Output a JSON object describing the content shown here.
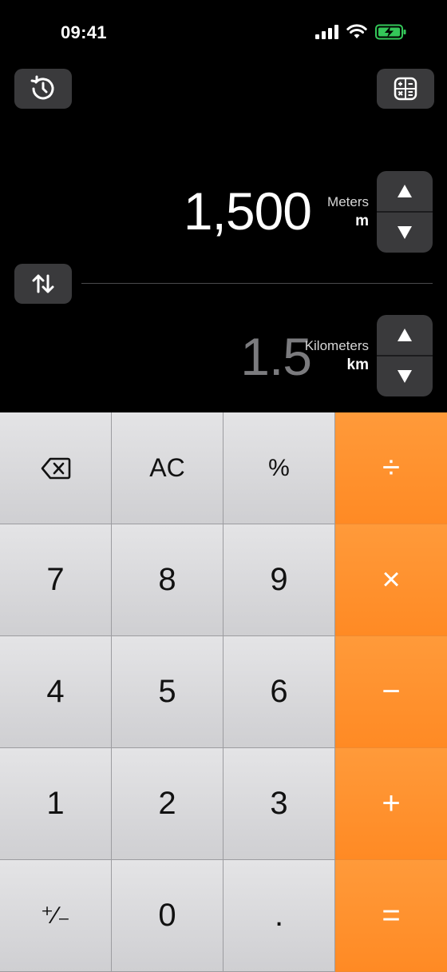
{
  "status_bar": {
    "time": "09:41"
  },
  "toolbar": {
    "history_icon": "history-icon",
    "calculator_icon": "calculator-icon"
  },
  "input": {
    "value": "1,500",
    "unit_name": "Meters",
    "unit_abbr": "m"
  },
  "output": {
    "value": "1.5",
    "unit_name": "Kilometers",
    "unit_abbr": "km"
  },
  "keypad": {
    "keys": [
      "⌫",
      "AC",
      "%",
      "÷",
      "7",
      "8",
      "9",
      "×",
      "4",
      "5",
      "6",
      "−",
      "1",
      "2",
      "3",
      "+",
      "⁺∕₋",
      "0",
      ".",
      "="
    ],
    "backspace_icon": "backspace-icon"
  },
  "colors": {
    "operator": "#ff9a3a",
    "key": "#d9d9dc",
    "button_bg": "#3a3a3c",
    "battery": "#34c759"
  }
}
